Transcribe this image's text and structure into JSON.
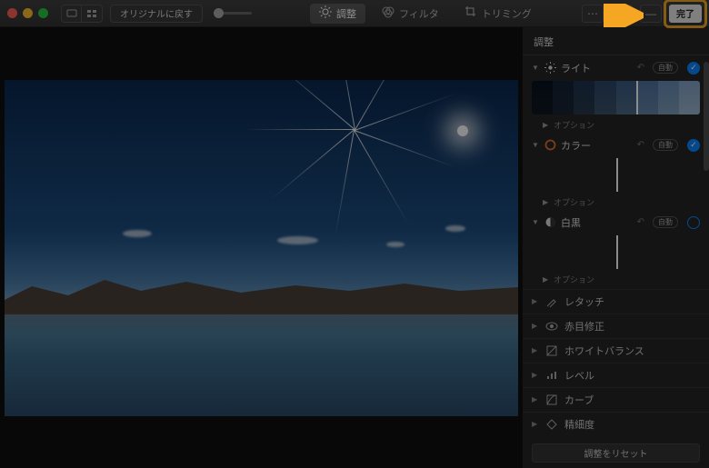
{
  "toolbar": {
    "revert_label": "オリジナルに戻す",
    "tabs": {
      "adjust": "調整",
      "filter": "フィルタ",
      "crop": "トリミング"
    },
    "done_label": "完了"
  },
  "sidebar": {
    "title": "調整",
    "auto_label": "自動",
    "options_label": "オプション",
    "sections": {
      "light": "ライト",
      "color": "カラー",
      "bw": "白黒"
    },
    "rows": {
      "retouch": "レタッチ",
      "redeye": "赤目修正",
      "whitebalance": "ホワイトバランス",
      "levels": "レベル",
      "curves": "カーブ",
      "definition": "精細度"
    },
    "reset_label": "調整をリセット"
  }
}
